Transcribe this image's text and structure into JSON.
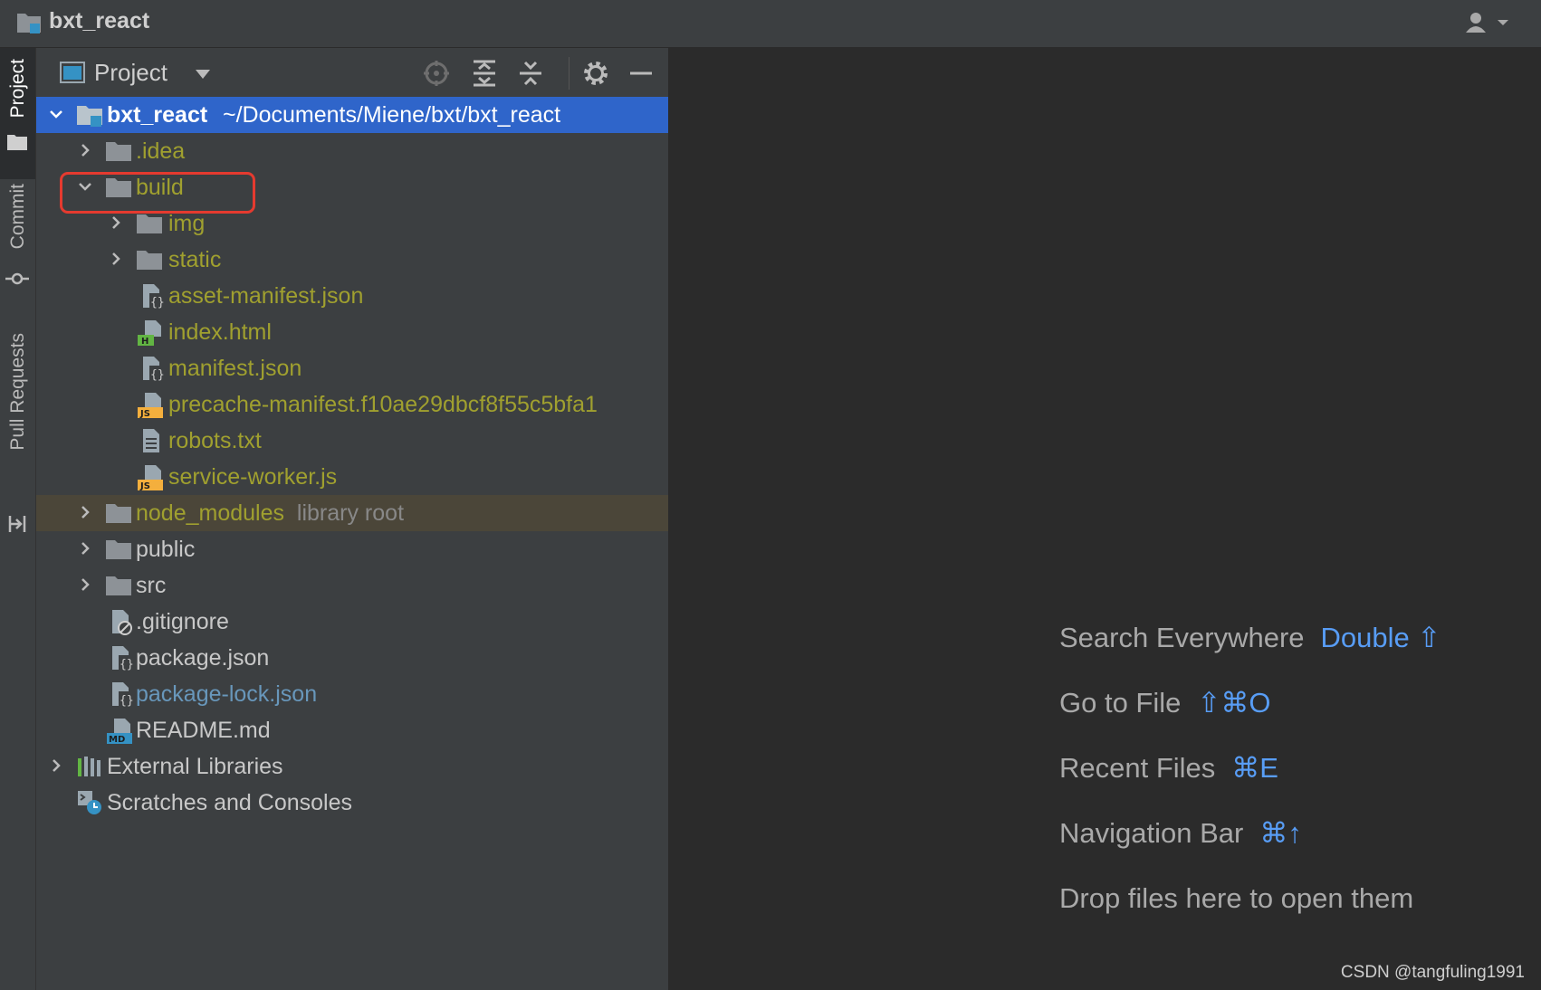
{
  "window": {
    "title": "bxt_react"
  },
  "tool_stripe": {
    "items": [
      {
        "label": "Project",
        "active": true
      },
      {
        "label": "Commit",
        "active": false
      },
      {
        "label": "Pull Requests",
        "active": false
      }
    ]
  },
  "project_panel": {
    "title": "Project",
    "toolbar_icons": [
      "locate-icon",
      "expand-all-icon",
      "collapse-all-icon",
      "gear-icon",
      "minimize-icon"
    ]
  },
  "tree": {
    "root": {
      "name": "bxt_react",
      "path": "~/Documents/Miene/bxt/bxt_react"
    },
    "items": [
      {
        "name": ".idea"
      },
      {
        "name": "build"
      },
      {
        "name": "img"
      },
      {
        "name": "static"
      },
      {
        "name": "asset-manifest.json"
      },
      {
        "name": "index.html"
      },
      {
        "name": "manifest.json"
      },
      {
        "name": "precache-manifest.f10ae29dbcf8f55c5bfa1"
      },
      {
        "name": "robots.txt"
      },
      {
        "name": "service-worker.js"
      },
      {
        "name": "node_modules",
        "note": "library root"
      },
      {
        "name": "public"
      },
      {
        "name": "src"
      },
      {
        "name": ".gitignore"
      },
      {
        "name": "package.json"
      },
      {
        "name": "package-lock.json"
      },
      {
        "name": "README.md"
      },
      {
        "name": "External Libraries"
      },
      {
        "name": "Scratches and Consoles"
      }
    ]
  },
  "editor_hints": [
    {
      "label": "Search Everywhere",
      "shortcut": "Double ⇧"
    },
    {
      "label": "Go to File",
      "shortcut": "⇧⌘O"
    },
    {
      "label": "Recent Files",
      "shortcut": "⌘E"
    },
    {
      "label": "Navigation Bar",
      "shortcut": "⌘↑"
    },
    {
      "label": "Drop files here to open them",
      "shortcut": ""
    }
  ],
  "watermark": "CSDN @tangfuling1991",
  "colors": {
    "selection": "#2f65ca",
    "excluded_olive": "#a0a02f",
    "modified_blue": "#6897bb",
    "shortcut_blue": "#589df6",
    "highlight_red": "#e53a2f"
  }
}
